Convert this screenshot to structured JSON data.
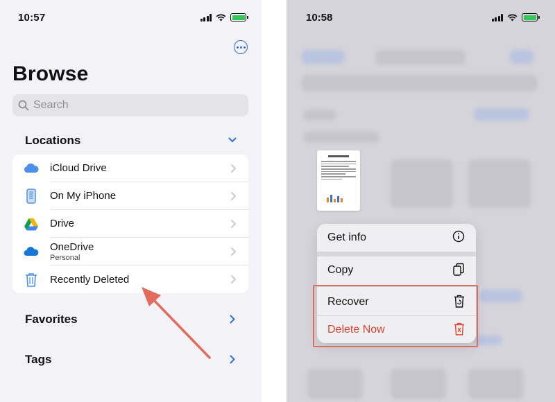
{
  "left": {
    "time": "10:57",
    "title": "Browse",
    "search": {
      "placeholder": "Search"
    },
    "locations": {
      "heading": "Locations",
      "items": [
        {
          "label": "iCloud Drive",
          "sub": "",
          "icon": "cloud-icon"
        },
        {
          "label": "On My iPhone",
          "sub": "",
          "icon": "iphone-icon"
        },
        {
          "label": "Drive",
          "sub": "",
          "icon": "google-drive-icon"
        },
        {
          "label": "OneDrive",
          "sub": "Personal",
          "icon": "onedrive-icon"
        },
        {
          "label": "Recently Deleted",
          "sub": "",
          "icon": "trash-icon"
        }
      ]
    },
    "favorites": {
      "heading": "Favorites"
    },
    "tags": {
      "heading": "Tags"
    }
  },
  "right": {
    "time": "10:58",
    "menu": {
      "items": [
        {
          "label": "Get info",
          "icon": "info-icon"
        },
        {
          "label": "Copy",
          "icon": "copy-icon"
        },
        {
          "label": "Recover",
          "icon": "recover-trash-icon"
        },
        {
          "label": "Delete Now",
          "icon": "delete-trash-icon"
        }
      ]
    }
  },
  "colors": {
    "accent": "#2f6fe0",
    "destructive": "#d9442f",
    "annotation": "#e26b5e",
    "battery": "#34c759"
  }
}
